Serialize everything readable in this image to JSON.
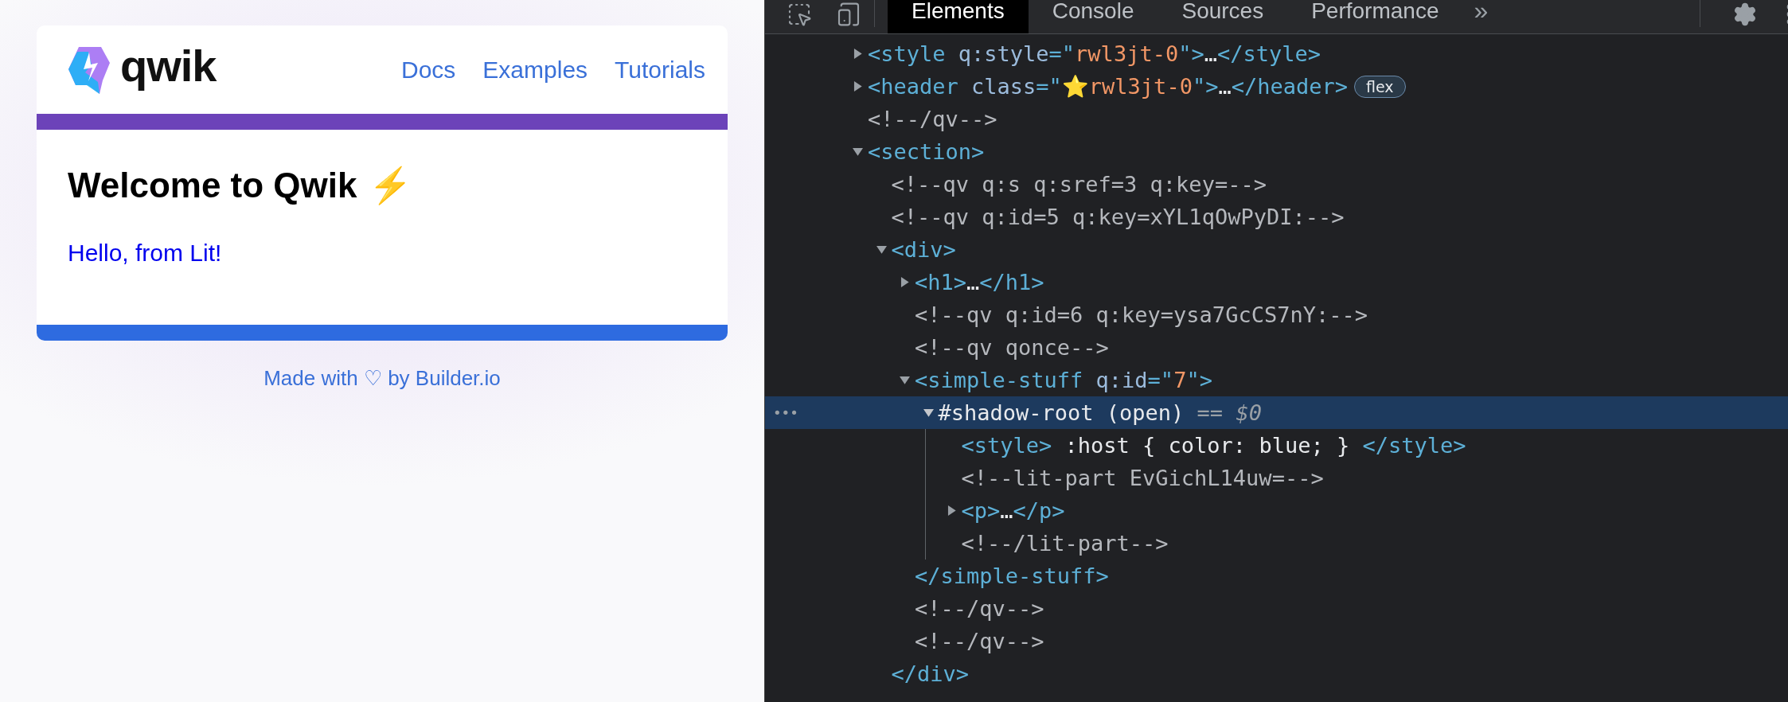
{
  "preview": {
    "logo": {
      "wordmark": "qwik"
    },
    "nav": [
      {
        "label": "Docs"
      },
      {
        "label": "Examples"
      },
      {
        "label": "Tutorials"
      }
    ],
    "heading": {
      "text": "Welcome to Qwik",
      "emoji": "⚡"
    },
    "message": "Hello, from Lit!",
    "footer": "Made with ♡ by Builder.io"
  },
  "devtools": {
    "tabs": [
      {
        "label": "Elements",
        "selected": true
      },
      {
        "label": "Console",
        "selected": false
      },
      {
        "label": "Sources",
        "selected": false
      },
      {
        "label": "Performance",
        "selected": false
      }
    ],
    "overflow": "»",
    "row_menu": "•••",
    "tree": [
      {
        "kind": "element",
        "expanded": false,
        "selected": false,
        "parts": [
          {
            "kind": "tag",
            "text": "<style "
          },
          {
            "kind": "attr",
            "text": "q:style"
          },
          {
            "kind": "tag",
            "text": "=\""
          },
          {
            "kind": "value",
            "text": "rwl3jt-0"
          },
          {
            "kind": "tag",
            "text": "\">"
          },
          {
            "kind": "text",
            "text": "…"
          },
          {
            "kind": "tag",
            "text": "</style>"
          }
        ]
      },
      {
        "kind": "element",
        "expanded": false,
        "selected": false,
        "badge": "flex",
        "parts": [
          {
            "kind": "tag",
            "text": "<header "
          },
          {
            "kind": "attr",
            "text": "class"
          },
          {
            "kind": "tag",
            "text": "=\""
          },
          {
            "kind": "value",
            "text": "⭐rwl3jt-0"
          },
          {
            "kind": "tag",
            "text": "\">"
          },
          {
            "kind": "text",
            "text": "…"
          },
          {
            "kind": "tag",
            "text": "</header>"
          }
        ]
      },
      {
        "kind": "comment",
        "selected": false,
        "parts": [
          {
            "kind": "comment",
            "text": "<!--/qv-->"
          }
        ]
      },
      {
        "kind": "element",
        "expanded": true,
        "selected": false,
        "parts": [
          {
            "kind": "tag",
            "text": "<section>"
          }
        ],
        "children": [
          {
            "kind": "comment",
            "selected": false,
            "parts": [
              {
                "kind": "comment",
                "text": "<!--qv q:s q:sref=3 q:key=-->"
              }
            ]
          },
          {
            "kind": "comment",
            "selected": false,
            "parts": [
              {
                "kind": "comment",
                "text": "<!--qv q:id=5 q:key=xYL1qOwPyDI:-->"
              }
            ]
          },
          {
            "kind": "element",
            "expanded": true,
            "selected": false,
            "parts": [
              {
                "kind": "tag",
                "text": "<div>"
              }
            ],
            "closing": "</div>",
            "children": [
              {
                "kind": "element",
                "expanded": false,
                "selected": false,
                "parts": [
                  {
                    "kind": "tag",
                    "text": "<h1>"
                  },
                  {
                    "kind": "text",
                    "text": "…"
                  },
                  {
                    "kind": "tag",
                    "text": "</h1>"
                  }
                ]
              },
              {
                "kind": "comment",
                "selected": false,
                "parts": [
                  {
                    "kind": "comment",
                    "text": "<!--qv q:id=6 q:key=ysa7GcCS7nY:-->"
                  }
                ]
              },
              {
                "kind": "comment",
                "selected": false,
                "parts": [
                  {
                    "kind": "comment",
                    "text": "<!--qv qonce-->"
                  }
                ]
              },
              {
                "kind": "element",
                "expanded": true,
                "selected": false,
                "parts": [
                  {
                    "kind": "tag",
                    "text": "<simple-stuff "
                  },
                  {
                    "kind": "attr",
                    "text": "q:id"
                  },
                  {
                    "kind": "tag",
                    "text": "=\""
                  },
                  {
                    "kind": "value",
                    "text": "7"
                  },
                  {
                    "kind": "tag",
                    "text": "\">"
                  }
                ],
                "closing": "</simple-stuff>",
                "children": [
                  {
                    "kind": "shadow",
                    "expanded": true,
                    "selected": true,
                    "parts": [
                      {
                        "kind": "text",
                        "text": "#shadow-root (open)"
                      },
                      {
                        "kind": "muted",
                        "text": " == "
                      },
                      {
                        "kind": "ref",
                        "text": "$0"
                      }
                    ],
                    "children": [
                      {
                        "kind": "inline",
                        "selected": false,
                        "parts": [
                          {
                            "kind": "tag",
                            "text": "<style>"
                          },
                          {
                            "kind": "text",
                            "text": " :host { color: blue; } "
                          },
                          {
                            "kind": "tag",
                            "text": "</style>"
                          }
                        ]
                      },
                      {
                        "kind": "comment",
                        "selected": false,
                        "parts": [
                          {
                            "kind": "comment",
                            "text": "<!--lit-part EvGichL14uw=-->"
                          }
                        ]
                      },
                      {
                        "kind": "element",
                        "expanded": false,
                        "selected": false,
                        "parts": [
                          {
                            "kind": "tag",
                            "text": "<p>"
                          },
                          {
                            "kind": "text",
                            "text": "…"
                          },
                          {
                            "kind": "tag",
                            "text": "</p>"
                          }
                        ]
                      },
                      {
                        "kind": "comment",
                        "selected": false,
                        "parts": [
                          {
                            "kind": "comment",
                            "text": "<!--/lit-part-->"
                          }
                        ]
                      }
                    ]
                  }
                ]
              },
              {
                "kind": "comment",
                "selected": false,
                "parts": [
                  {
                    "kind": "comment",
                    "text": "<!--/qv-->"
                  }
                ]
              },
              {
                "kind": "comment",
                "selected": false,
                "parts": [
                  {
                    "kind": "comment",
                    "text": "<!--/qv-->"
                  }
                ]
              }
            ]
          }
        ]
      }
    ]
  }
}
